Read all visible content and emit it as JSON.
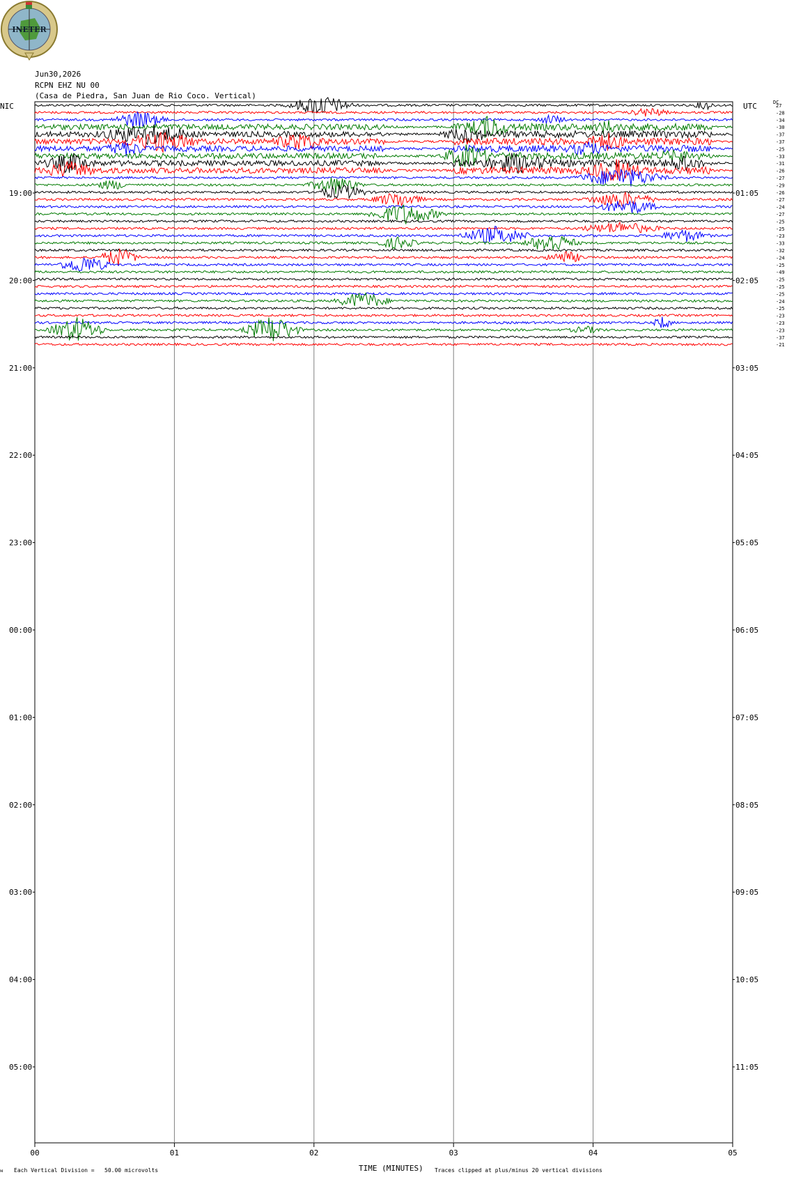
{
  "header": {
    "date": "Jun30,2026",
    "station": "RCPN EHZ NU 00",
    "location": "(Casa de Piedra, San Juan de Rio Coco. Vertical)",
    "left_zone": "NIC",
    "right_zone": "UTC",
    "dc_label": "DC"
  },
  "logo": {
    "text": "INETER"
  },
  "footer": {
    "vertical_division": "Each Vertical Division =   50.00 microvolts",
    "xlabel": "TIME (MINUTES)",
    "clip_note": "Traces clipped at plus/minus 20 vertical divisions",
    "corner_mark": "ᴍ"
  },
  "chart_data": {
    "type": "line",
    "title": "RCPN EHZ NU 00",
    "xlabel": "TIME (MINUTES)",
    "xlim": [
      0,
      5
    ],
    "x_ticks": [
      "00",
      "01",
      "02",
      "03",
      "04",
      "05"
    ],
    "y_ticks_left": [
      "19:00",
      "20:00",
      "21:00",
      "22:00",
      "23:00",
      "00:00",
      "01:00",
      "02:00",
      "03:00",
      "04:00",
      "05:00"
    ],
    "y_ticks_right": [
      "01:05",
      "02:05",
      "03:05",
      "04:05",
      "05:05",
      "06:05",
      "07:05",
      "08:05",
      "09:05",
      "10:05",
      "11:05"
    ],
    "trace_colors": [
      "#000000",
      "#ff0000",
      "#0000ff",
      "#007a00"
    ],
    "dc_offsets": [
      "27",
      "-28",
      "-34",
      "-30",
      "-37",
      "-37",
      "-25",
      "-33",
      "-31",
      "-26",
      "-27",
      "-29",
      "-26",
      "-27",
      "-24",
      "-27",
      "-25",
      "-25",
      "-23",
      "-33",
      "-32",
      "-24",
      "-25",
      "-49",
      "-25",
      "-25",
      "-25",
      "-24",
      "-25",
      "-23",
      "-23",
      "-23",
      "-37",
      "-21"
    ],
    "trace_count": 34,
    "grid": true
  }
}
